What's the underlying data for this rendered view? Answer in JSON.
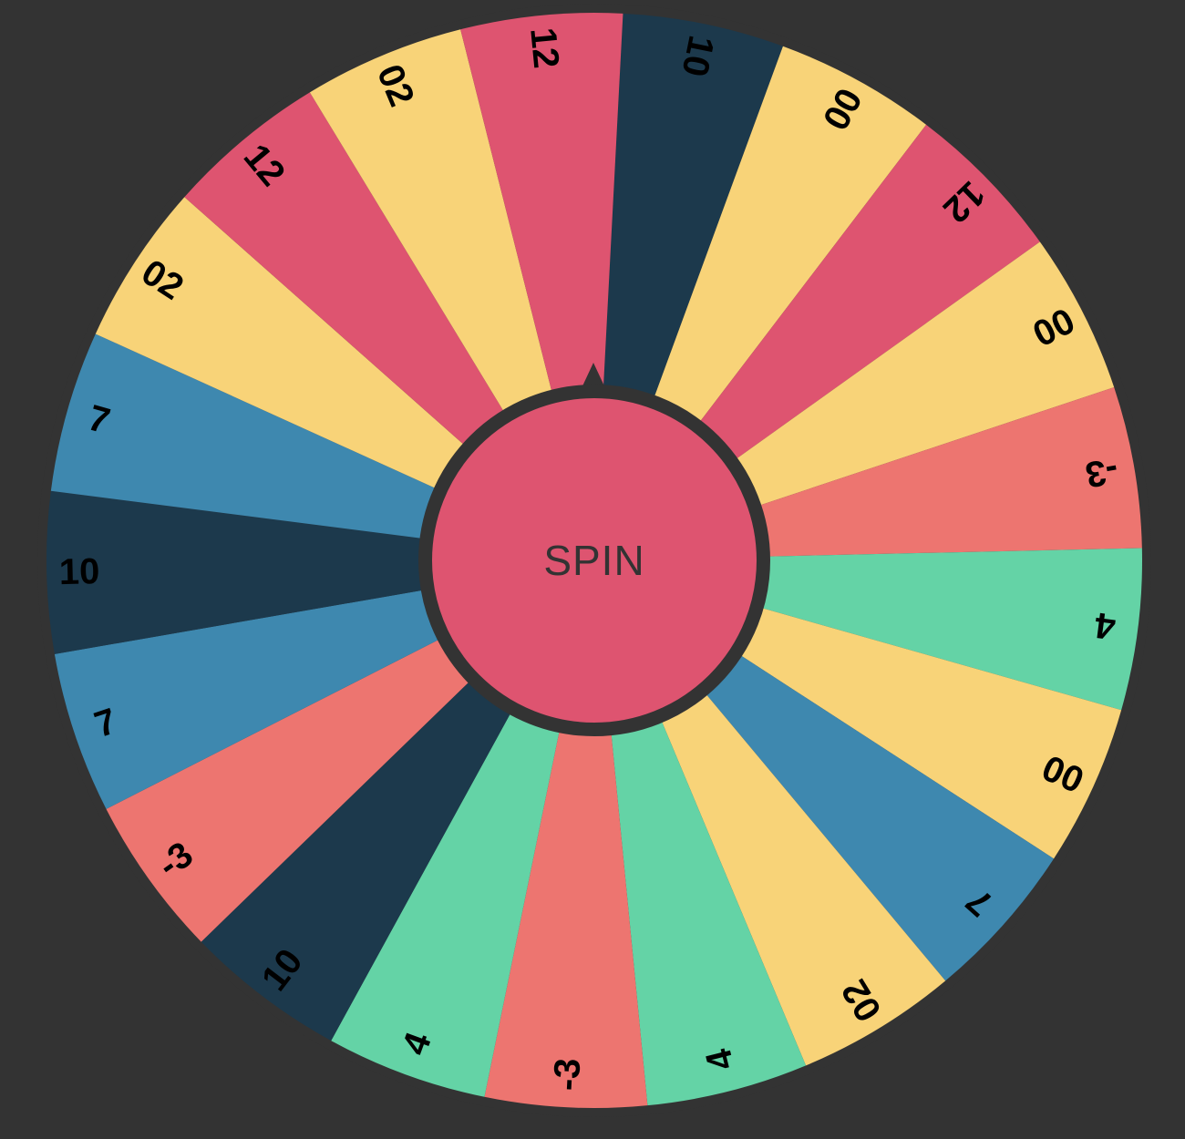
{
  "spin_button": {
    "label": "SPIN"
  },
  "colors": {
    "background": "#333333",
    "rim": "#333333",
    "pink": "#DE5470",
    "yellow": "#F8D378",
    "navy": "#1C394C",
    "blue": "#3E88AF",
    "coral": "#ED7570",
    "green": "#64D3A6"
  },
  "wheel": {
    "segments": [
      {
        "label": "10",
        "color": "navy"
      },
      {
        "label": "00",
        "color": "yellow"
      },
      {
        "label": "12",
        "color": "pink"
      },
      {
        "label": "00",
        "color": "yellow"
      },
      {
        "label": "-3",
        "color": "coral"
      },
      {
        "label": "4",
        "color": "green"
      },
      {
        "label": "00",
        "color": "yellow"
      },
      {
        "label": "7",
        "color": "blue"
      },
      {
        "label": "02",
        "color": "yellow"
      },
      {
        "label": "4",
        "color": "green"
      },
      {
        "label": "-3",
        "color": "coral"
      },
      {
        "label": "4",
        "color": "green"
      },
      {
        "label": "10",
        "color": "navy"
      },
      {
        "label": "-3",
        "color": "coral"
      },
      {
        "label": "7",
        "color": "blue"
      },
      {
        "label": "10",
        "color": "navy"
      },
      {
        "label": "7",
        "color": "blue"
      },
      {
        "label": "02",
        "color": "yellow"
      },
      {
        "label": "12",
        "color": "pink"
      },
      {
        "label": "02",
        "color": "yellow"
      },
      {
        "label": "12",
        "color": "pink"
      }
    ]
  }
}
